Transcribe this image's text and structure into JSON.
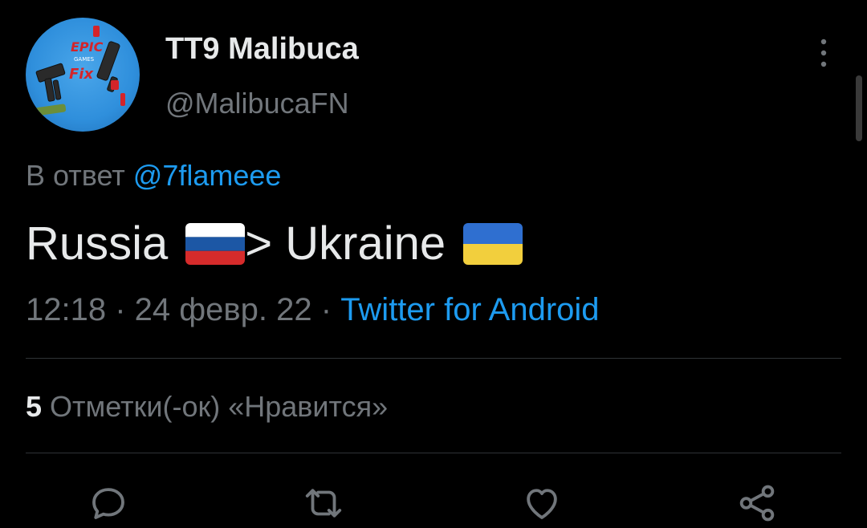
{
  "author": {
    "display_name": "TT9 Malibuca",
    "handle": "@MalibucaFN",
    "avatar_icon": "avatar-image",
    "avatar_text_top": "EPIC",
    "avatar_text_mid": "GAMES",
    "avatar_text_bottom": "Fix"
  },
  "reply": {
    "prefix": "В ответ",
    "mention": "@7flameee"
  },
  "tweet": {
    "text_part1": "Russia",
    "text_part2": "> Ukraine",
    "flag1_icon": "russia-flag-icon",
    "flag2_icon": "ukraine-flag-icon"
  },
  "meta": {
    "time": "12:18",
    "separator": " · ",
    "date": "24 февр. 22",
    "source": "Twitter for Android"
  },
  "stats": {
    "likes_count": "5",
    "likes_label": "Отметки(-ок) «Нравится»"
  },
  "actions": [
    "reply-icon",
    "retweet-icon",
    "like-icon",
    "share-icon"
  ],
  "colors": {
    "background": "#000000",
    "text": "#e7e9ea",
    "secondary": "#71767b",
    "accent": "#1d9bf0",
    "divider": "#2f3336"
  }
}
